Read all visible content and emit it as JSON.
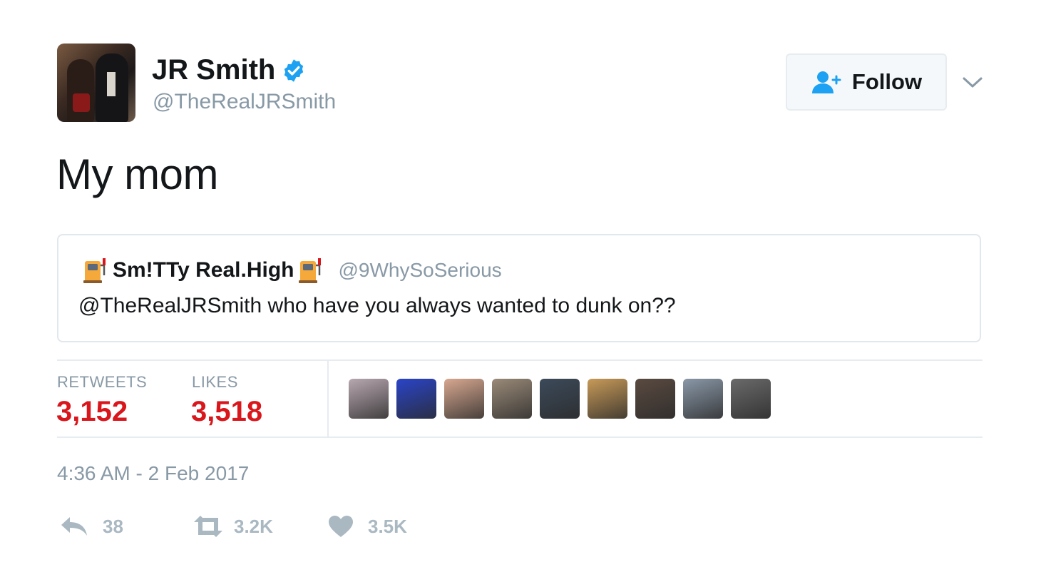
{
  "author": {
    "display_name": "JR Smith",
    "handle": "@TheRealJRSmith",
    "verified": true
  },
  "follow_button": {
    "label": "Follow"
  },
  "tweet": {
    "text": "My mom"
  },
  "quoted_tweet": {
    "display_name": "Sm!TTy Real.High",
    "handle": "@9WhySoSerious",
    "text": "@TheRealJRSmith who have you always wanted to dunk on??"
  },
  "stats": {
    "retweets_label": "RETWEETS",
    "retweets_value": "3,152",
    "likes_label": "LIKES",
    "likes_value": "3,518"
  },
  "liker_avatars": [
    "#b8a8b0",
    "#2a44c8",
    "#d8a890",
    "#9a8a78",
    "#3c4a5a",
    "#c89a58",
    "#5a4a40",
    "#8a98a8",
    "#6a6a6a"
  ],
  "timestamp": "4:36 AM - 2 Feb 2017",
  "actions": {
    "reply_count": "38",
    "retweet_count": "3.2K",
    "like_count": "3.5K"
  },
  "colors": {
    "stat_value": "#d9161c",
    "muted": "#8899a6",
    "verified_blue": "#1da1f2"
  }
}
